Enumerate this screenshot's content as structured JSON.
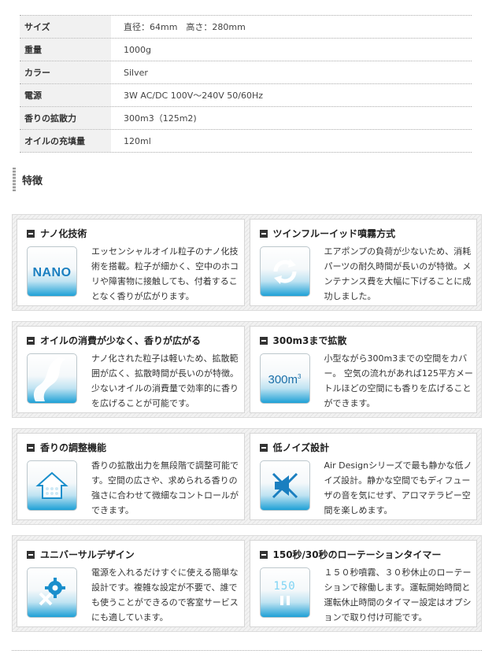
{
  "spec": [
    {
      "label": "サイズ",
      "value": "直径：64mm　高さ：280mm"
    },
    {
      "label": "重量",
      "value": "1000g"
    },
    {
      "label": "カラー",
      "value": "Silver"
    },
    {
      "label": "電源",
      "value": "3W AC/DC 100V～240V 50/60Hz"
    },
    {
      "label": "香りの拡散力",
      "value": "300m3（125m2)"
    },
    {
      "label": "オイルの充填量",
      "value": "120ml"
    }
  ],
  "section_title": "特徴",
  "features": [
    {
      "title": "ナノ化技術",
      "icon": "nano-icon",
      "icon_text": "NANO",
      "desc": "エッセンシャルオイル粒子のナノ化技術を搭載。粒子が細かく、空中のホコリや障害物に接触しても、付着することなく香りが広がります。"
    },
    {
      "title": "ツインフルーイッド噴霧方式",
      "icon": "recycle-arrows-icon",
      "desc": "エアポンプの負荷が少ないため、消耗パーツの耐久時間が長いのが特徴。メンテナンス費を大幅に下げることに成功しました。"
    },
    {
      "title": "オイルの消費が少なく、香りが広がる",
      "icon": "mist-wave-icon",
      "desc": "ナノ化された粒子は軽いため、拡散範囲が広く、拡散時間が長いのが特徴。少ないオイルの消費量で効率的に香りを広げることが可能です。"
    },
    {
      "title": "300m3まで拡散",
      "icon": "volume-300-icon",
      "icon_text": "300m",
      "desc": "小型ながら300m3までの空間をカバー。 空気の流れがあれば125平方メートルほどの空間にも香りを広げることができます。"
    },
    {
      "title": "香りの調整機能",
      "icon": "house-icon",
      "desc": "香りの拡散出力を無段階で調整可能です。空間の広さや、求められる香りの強さに合わせて微細なコントロールができます。"
    },
    {
      "title": "低ノイズ設計",
      "icon": "mute-speaker-icon",
      "desc": "Air Designシリーズで最も静かな低ノイズ設計。静かな空間でもディフューザの音を気にせず、アロマテラピー空間を楽しめます。"
    },
    {
      "title": "ユニバーサルデザイン",
      "icon": "gear-tools-icon",
      "desc": "電源を入れるだけすぐに使える簡単な設計です。複雑な設定が不要で、誰でも使うことができるので客室サービスにも適しています。"
    },
    {
      "title": "150秒/30秒のローテーションタイマー",
      "icon": "timer-display-icon",
      "icon_text": "150",
      "desc": "１５０秒噴霧、３０秒休止のローテーションで稼働します。運転開始時間と運転休止時間のタイマー設定はオプションで取り付け可能です。"
    }
  ]
}
